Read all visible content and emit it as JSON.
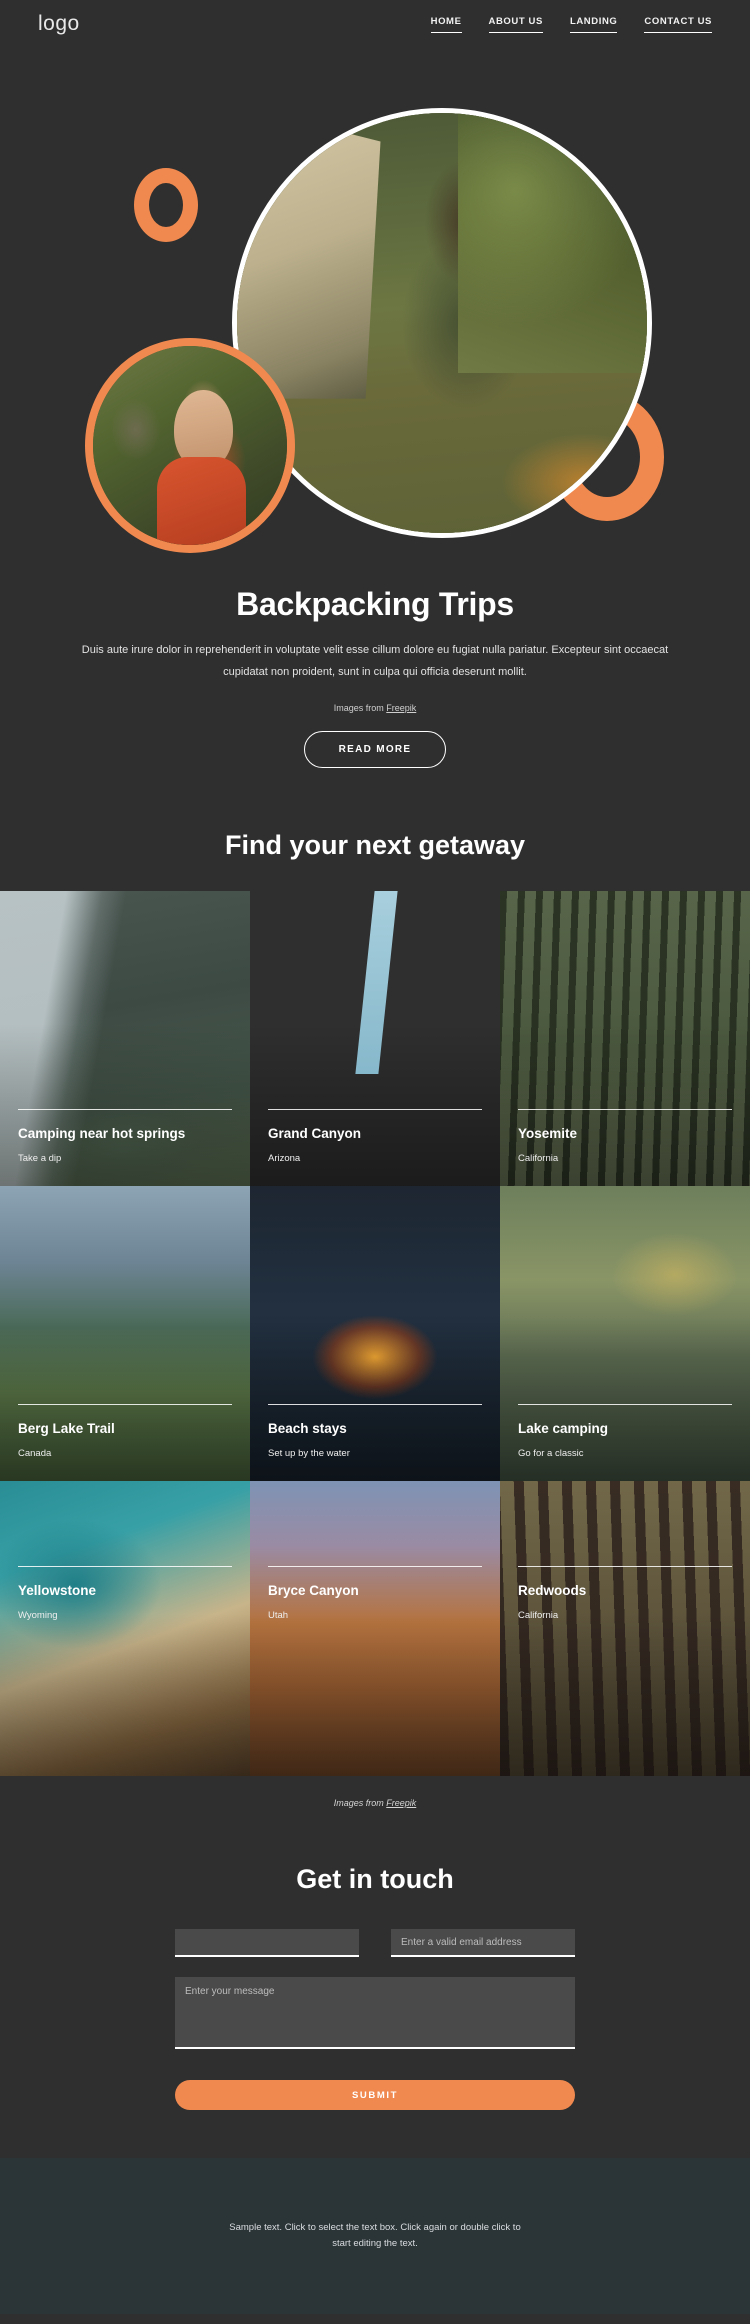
{
  "nav": {
    "logo": "logo",
    "links": [
      {
        "label": "HOME"
      },
      {
        "label": "ABOUT US"
      },
      {
        "label": "LANDING"
      },
      {
        "label": "CONTACT US"
      }
    ]
  },
  "hero": {
    "title": "Backpacking Trips",
    "description": "Duis aute irure dolor in reprehenderit in voluptate velit esse cillum dolore eu fugiat nulla pariatur. Excepteur sint occaecat cupidatat non proident, sunt in culpa qui officia deserunt mollit.",
    "credit_prefix": "Images from ",
    "credit_link": "Freepik",
    "cta_label": "READ MORE",
    "accent_color": "#f0894f",
    "border_color": "#ffffff"
  },
  "gallery": {
    "title": "Find your next getaway",
    "credit_prefix": "Images from ",
    "credit_link": "Freepik",
    "cards": [
      {
        "title": "Camping near hot springs",
        "subtitle": "Take a dip"
      },
      {
        "title": "Grand Canyon",
        "subtitle": "Arizona"
      },
      {
        "title": "Yosemite",
        "subtitle": "California"
      },
      {
        "title": "Berg Lake Trail",
        "subtitle": "Canada"
      },
      {
        "title": "Beach stays",
        "subtitle": "Set up by the water"
      },
      {
        "title": "Lake camping",
        "subtitle": "Go for a classic"
      },
      {
        "title": "Yellowstone",
        "subtitle": "Wyoming"
      },
      {
        "title": "Bryce Canyon",
        "subtitle": "Utah"
      },
      {
        "title": "Redwoods",
        "subtitle": "California"
      }
    ]
  },
  "contact": {
    "title": "Get in touch",
    "name_value": "",
    "name_placeholder": "",
    "email_placeholder": "Enter a valid email address",
    "email_value": "",
    "message_placeholder": "Enter your message",
    "message_value": "",
    "submit_label": "SUBMIT",
    "submit_color": "#f0894f"
  },
  "footer": {
    "text": "Sample text. Click to select the text box. Click again or double click to start editing the text.",
    "background": "#2b3437"
  }
}
